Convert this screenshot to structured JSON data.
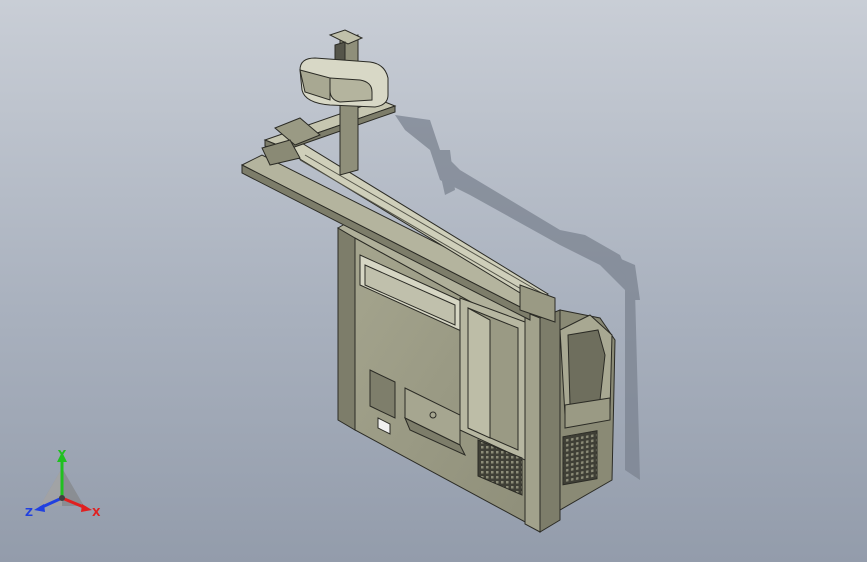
{
  "viewport": {
    "background_top": "#c9ced6",
    "background_bottom": "#939cab"
  },
  "model": {
    "body_color": "#9c9c86",
    "shade_color": "#7d7d6a",
    "dark_color": "#555548",
    "shadow_color": "#7b8390"
  },
  "triad": {
    "x_label": "X",
    "y_label": "Y",
    "z_label": "Z",
    "x_color": "#e02020",
    "y_color": "#20c020",
    "z_color": "#2040e0"
  }
}
